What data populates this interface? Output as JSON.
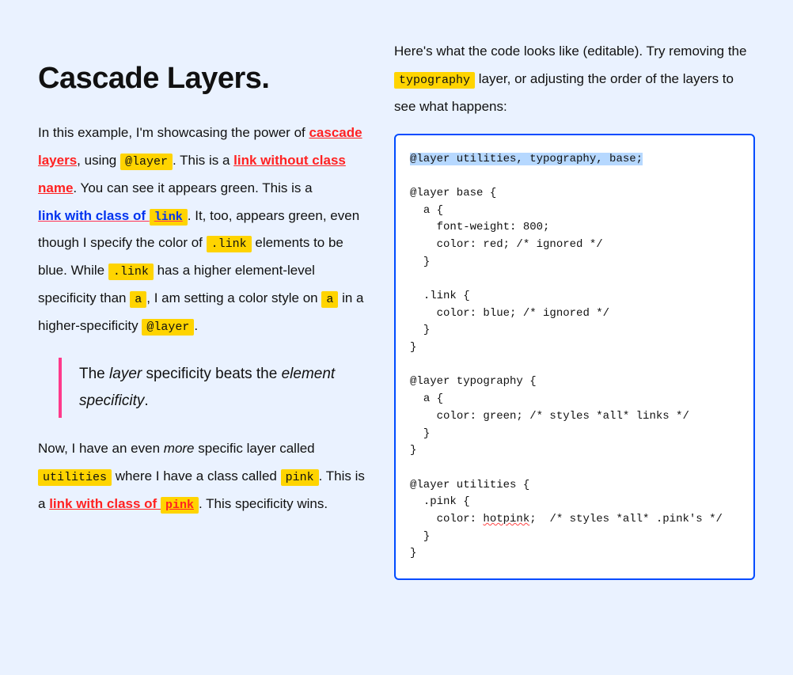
{
  "heading": "Cascade Layers.",
  "left": {
    "p1_a": "In this example, I'm showcasing the power of ",
    "link_cascade_layers": "cascade layers",
    "p1_b": ", using ",
    "code_layer1": "@layer",
    "p1_c": ". This is a ",
    "link_wo_class": "link without class name",
    "p1_d": ". You can see it appears green. This is a ",
    "link_with_class_pre": "link with class of ",
    "code_link_in_link": "link",
    "p1_e": ". It, too, appears green, even though I specify the color of ",
    "code_dot_link1": ".link",
    "p1_f": " elements to be blue. While ",
    "code_dot_link2": ".link",
    "p1_g": " has a higher element-level specificity than ",
    "code_a1": "a",
    "p1_h": ", I am setting a color style on ",
    "code_a2": "a",
    "p1_i": " in a higher-specificity ",
    "code_layer2": "@layer",
    "p1_j": ".",
    "bq_a": "The ",
    "bq_em1": "layer",
    "bq_b": " specificity beats the ",
    "bq_em2": "element specificity",
    "bq_c": ".",
    "p2_a": "Now, I have an even ",
    "p2_more": "more",
    "p2_b": " specific layer called ",
    "code_utilities": "utilities",
    "p2_c": " where I have a class called ",
    "code_pink": "pink",
    "p2_d": ". This is a ",
    "link_pink_pre": "link with class of ",
    "code_pink_in_link": "pink",
    "p2_e": ". This specificity wins."
  },
  "right": {
    "intro_a": "Here's what the code looks like (editable). Try removing the ",
    "code_typography": "typography",
    "intro_b": " layer, or adjusting the order of the layers to see what happens:",
    "code": {
      "l1": "@layer utilities, typography, base;",
      "l2": "",
      "l3": "@layer base {",
      "l4": "  a {",
      "l5": "    font-weight: 800;",
      "l6": "    color: red; /* ignored */",
      "l7": "  }",
      "l8": "",
      "l9": "  .link {",
      "l10": "    color: blue; /* ignored */",
      "l11": "  }",
      "l12": "}",
      "l13": "",
      "l14": "@layer typography {",
      "l15": "  a {",
      "l16": "    color: green; /* styles *all* links */",
      "l17": "  }",
      "l18": "}",
      "l19": "",
      "l20": "@layer utilities {",
      "l21": "  .pink {",
      "l22a": "    color: ",
      "l22b": "hotpink",
      "l22c": ";  /* styles *all* .pink's */",
      "l23": "  }",
      "l24": "}"
    }
  }
}
